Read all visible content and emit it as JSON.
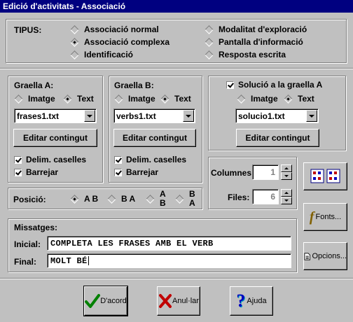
{
  "window": {
    "title": "Edició d'activitats - Associació"
  },
  "tipus": {
    "label": "TIPUS:",
    "options": [
      "Associació normal",
      "Associació complexa",
      "Identificació",
      "Modalitat d'exploració",
      "Pantalla d'informació",
      "Resposta escrita"
    ],
    "selected": "Associació complexa"
  },
  "graella_a": {
    "title": "Graella A:",
    "opt_image": "Imatge",
    "opt_text": "Text",
    "selected": "Text",
    "file": "frases1.txt",
    "edit_label": "Editar contingut",
    "delim_label": "Delim. caselles",
    "delim_checked": true,
    "barrejar_label": "Barrejar",
    "barrejar_checked": true
  },
  "graella_b": {
    "title": "Graella B:",
    "opt_image": "Imatge",
    "opt_text": "Text",
    "selected": "Text",
    "file": "verbs1.txt",
    "edit_label": "Editar contingut",
    "delim_label": "Delim. caselles",
    "delim_checked": true,
    "barrejar_label": "Barrejar",
    "barrejar_checked": true
  },
  "solucio": {
    "check_label": "Solució a la graella A",
    "checked": true,
    "opt_image": "Imatge",
    "opt_text": "Text",
    "selected": "Text",
    "file": "solucio1.txt",
    "edit_label": "Editar contingut"
  },
  "posicio": {
    "label": "Posició:",
    "options": [
      {
        "l1": "A B",
        "l2": ""
      },
      {
        "l1": "B A",
        "l2": ""
      },
      {
        "l1": "A",
        "l2": "B"
      },
      {
        "l1": "B",
        "l2": "A"
      }
    ],
    "selected_index": 0
  },
  "grid": {
    "columnes_label": "Columnes:",
    "columnes": "1",
    "files_label": "Files:",
    "files": "6"
  },
  "side_buttons": {
    "fonts": "Fonts...",
    "opcions": "Opcions..."
  },
  "missatges": {
    "title": "Missatges:",
    "inicial_label": "Inicial:",
    "inicial": "COMPLETA LES FRASES AMB EL VERB",
    "final_label": "Final:",
    "final": "MOLT BÉ"
  },
  "buttons": {
    "ok": "D'acord",
    "cancel": "Anul·lar",
    "help": "Ajuda"
  },
  "colors": {
    "titlebar": "#000080",
    "face": "#c0c0c0",
    "ok_check": "#008000",
    "cancel_x": "#c00000",
    "help": "#0000c0"
  }
}
